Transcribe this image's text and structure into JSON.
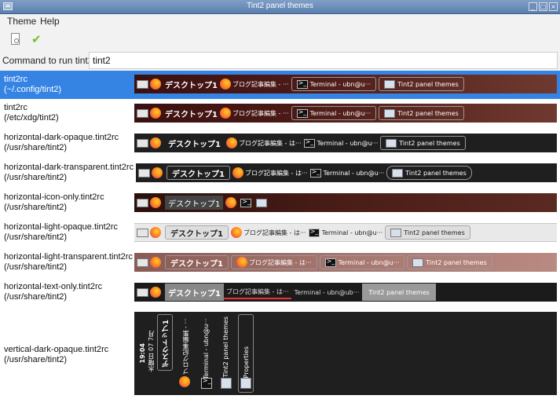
{
  "window": {
    "title": "Tint2 panel themes"
  },
  "menu": {
    "items": [
      "Theme",
      "Help"
    ]
  },
  "toolbar": {},
  "command": {
    "label": "Command to run tint2:",
    "value": "tint2"
  },
  "themes": [
    {
      "name": "tint2rc",
      "path": "(~/.config/tint2)",
      "selected": true
    },
    {
      "name": "tint2rc",
      "path": "(/etc/xdg/tint2)"
    },
    {
      "name": "horizontal-dark-opaque.tint2rc",
      "path": "(/usr/share/tint2)"
    },
    {
      "name": "horizontal-dark-transparent.tint2rc",
      "path": "(/usr/share/tint2)"
    },
    {
      "name": "horizontal-icon-only.tint2rc",
      "path": "(/usr/share/tint2)"
    },
    {
      "name": "horizontal-light-opaque.tint2rc",
      "path": "(/usr/share/tint2)"
    },
    {
      "name": "horizontal-light-transparent.tint2rc",
      "path": "(/usr/share/tint2)"
    },
    {
      "name": "horizontal-text-only.tint2rc",
      "path": "(/usr/share/tint2)"
    },
    {
      "name": "vertical-dark-opaque.tint2rc",
      "path": "(/usr/share/tint2)"
    }
  ],
  "preview": {
    "desktop": "デスクトップ1",
    "task_blog": "ブログ記事編集 - ···",
    "task_blog_short": "ブログ記事編集 - は···",
    "task_blog_text": "ブログ記事編集 - は···",
    "task_terminal": "Terminal - ubn@u···",
    "task_terminal_text": "Terminal - ubn@ub···",
    "task_tint2": "Tint2 panel themes",
    "vertical": {
      "clock_time": "19:04",
      "clock_date": "水曜日 07 7月",
      "desktop": "デスクトップ1",
      "task_blog": "ブログ記事編集 - ···",
      "task_terminal": "Terminal - ubn@u···",
      "task_tint2": "Tint2 panel themes",
      "task_props": "Properties"
    }
  },
  "colors": {
    "selection": "#3584e4",
    "titlebar": "#6d8cb6"
  }
}
